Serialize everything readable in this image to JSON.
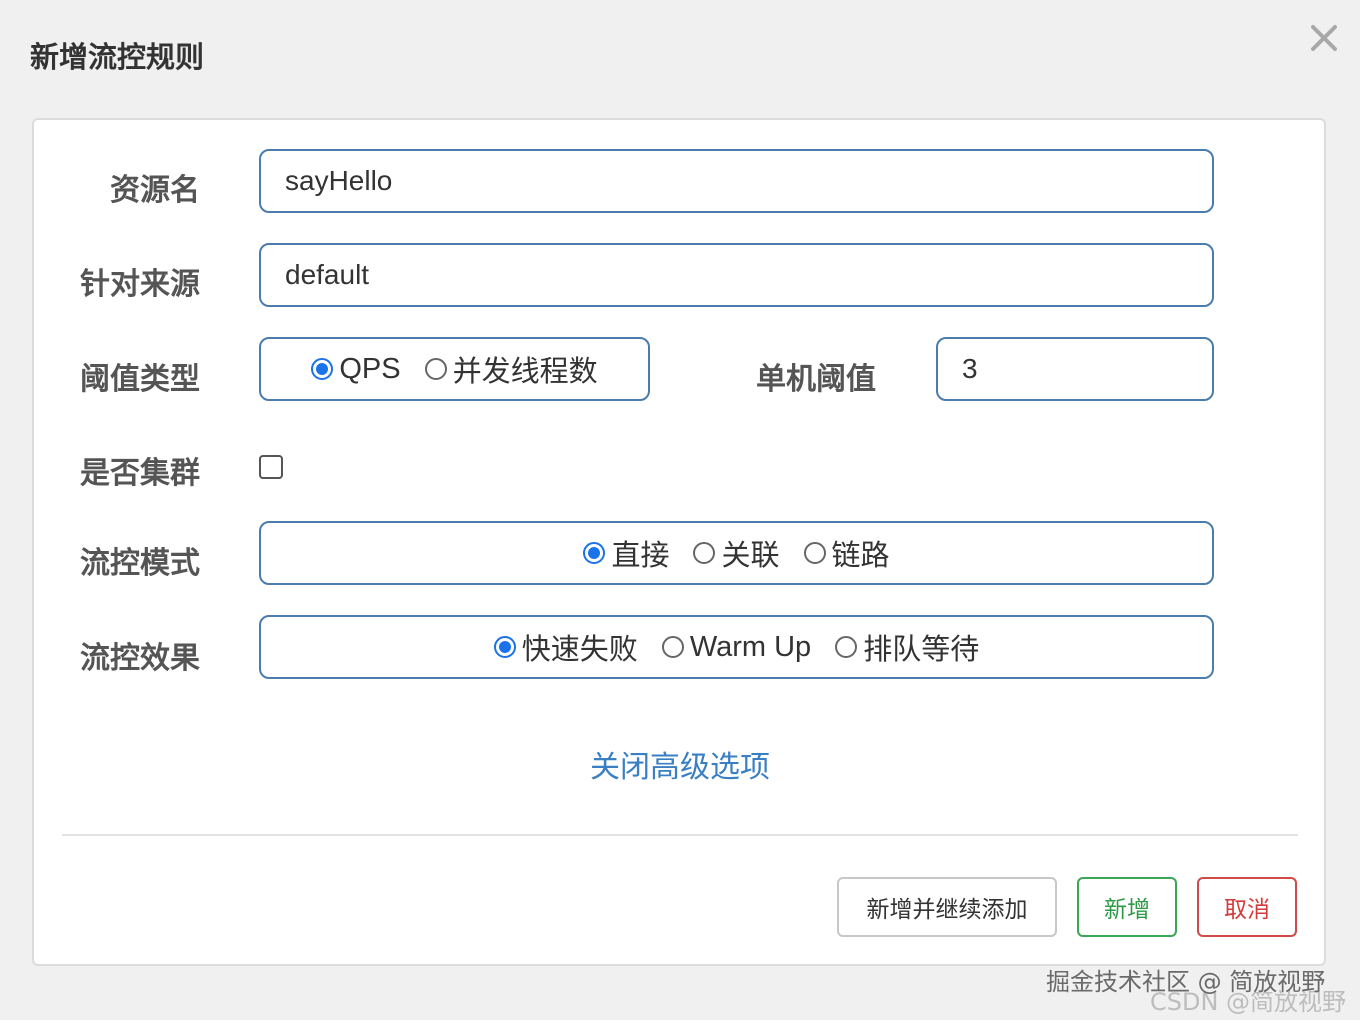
{
  "dialog": {
    "title": "新增流控规则"
  },
  "form": {
    "resource_name": {
      "label": "资源名",
      "value": "sayHello"
    },
    "limit_app": {
      "label": "针对来源",
      "value": "default"
    },
    "threshold_type": {
      "label": "阈值类型",
      "options": [
        "QPS",
        "并发线程数"
      ],
      "selected": "QPS"
    },
    "single_threshold": {
      "label": "单机阈值",
      "value": "3"
    },
    "cluster": {
      "label": "是否集群",
      "checked": false
    },
    "control_mode": {
      "label": "流控模式",
      "options": [
        "直接",
        "关联",
        "链路"
      ],
      "selected": "直接"
    },
    "control_effect": {
      "label": "流控效果",
      "options": [
        "快速失败",
        "Warm Up",
        "排队等待"
      ],
      "selected": "快速失败"
    },
    "advanced_toggle": "关闭高级选项"
  },
  "footer": {
    "add_continue_label": "新增并继续添加",
    "add_label": "新增",
    "cancel_label": "取消"
  },
  "watermarks": [
    "掘金技术社区 @ 简放视野",
    "CSDN @简放视野"
  ],
  "colors": {
    "accent": "#1a73e8",
    "field_border": "#4a7dad",
    "link": "#3a7fc4",
    "add_button": "#2d9a48",
    "cancel_button": "#d33a3a"
  }
}
